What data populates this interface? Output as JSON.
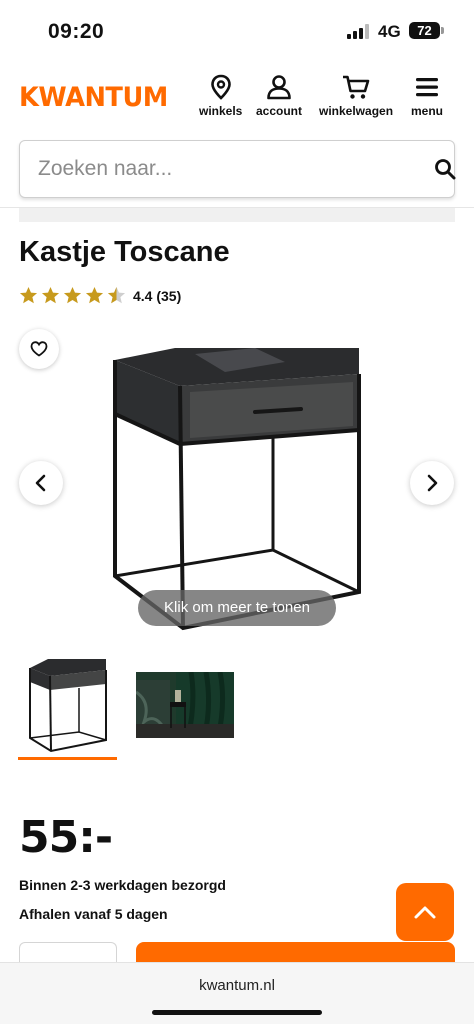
{
  "status_bar": {
    "time": "09:20",
    "network": "4G",
    "battery": "72"
  },
  "header": {
    "logo": "KWANTUM",
    "nav": [
      {
        "label": "winkels",
        "icon": "location-pin-icon"
      },
      {
        "label": "account",
        "icon": "user-icon"
      },
      {
        "label": "winkelwagen",
        "icon": "shopping-cart-icon"
      },
      {
        "label": "menu",
        "icon": "hamburger-menu-icon"
      }
    ]
  },
  "search": {
    "placeholder": "Zoeken naar...",
    "value": ""
  },
  "product": {
    "title": "Kastje Toscane",
    "rating_text": "4.4 (35)",
    "rating": 4.4,
    "more_label": "Klik om meer te tonen",
    "price": "55:-",
    "delivery": "Binnen 2-3 werkdagen bezorgd",
    "pickup": "Afhalen vanaf 5 dagen"
  },
  "browser": {
    "url": "kwantum.nl"
  },
  "colors": {
    "brand": "#ff6a00",
    "star": "#c79a1d"
  }
}
